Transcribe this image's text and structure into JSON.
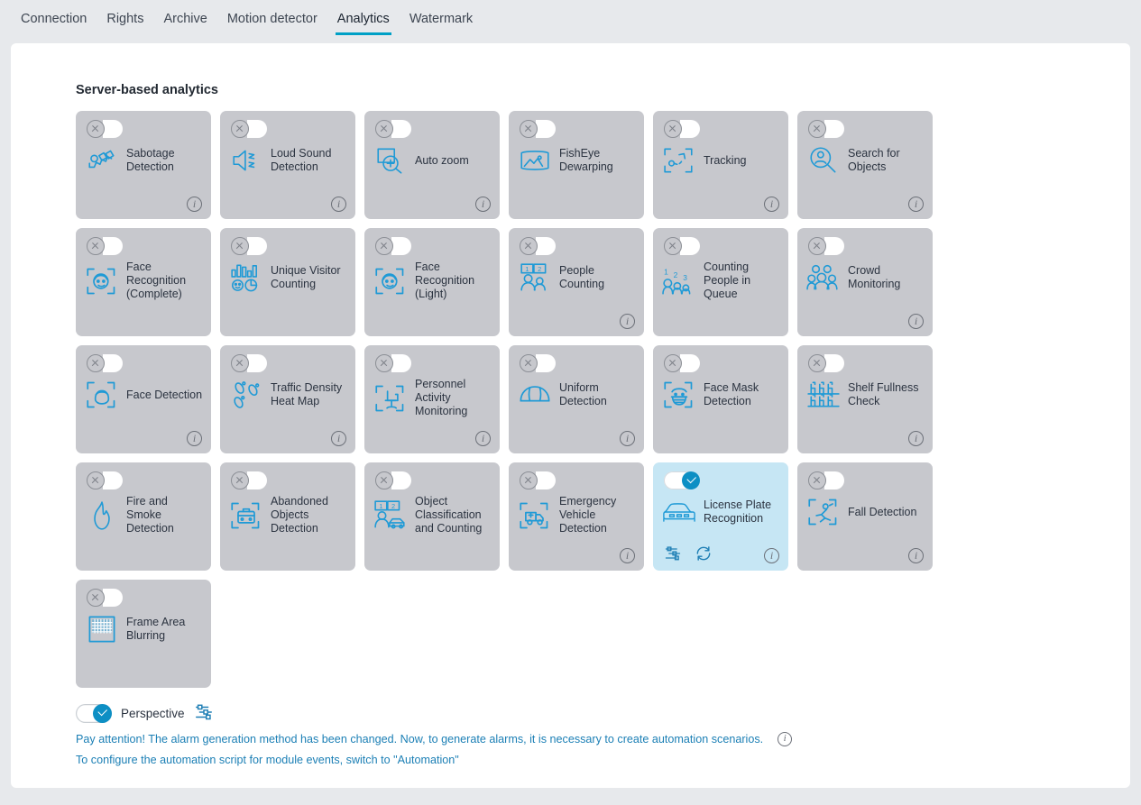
{
  "tabs": [
    {
      "label": "Connection",
      "active": false
    },
    {
      "label": "Rights",
      "active": false
    },
    {
      "label": "Archive",
      "active": false
    },
    {
      "label": "Motion detector",
      "active": false
    },
    {
      "label": "Analytics",
      "active": true
    },
    {
      "label": "Watermark",
      "active": false
    }
  ],
  "section": {
    "title": "Server-based analytics"
  },
  "colors": {
    "accent": "#00a0c6",
    "icon_blue": "#1f9ad6",
    "card_gray": "#c7c8cd",
    "card_active": "#c6e6f4",
    "page_bg": "#e7e9ec",
    "link_blue": "#1b7fb5"
  },
  "cards": [
    {
      "label": "Sabotage Detection",
      "icon": "sabotage-icon",
      "enabled": false,
      "info": true
    },
    {
      "label": "Loud Sound Detection",
      "icon": "loud-sound-icon",
      "enabled": false,
      "info": true
    },
    {
      "label": "Auto zoom",
      "icon": "auto-zoom-icon",
      "enabled": false,
      "info": true
    },
    {
      "label": "FishEye Dewarping",
      "icon": "fisheye-dewarping-icon",
      "enabled": false,
      "info": false
    },
    {
      "label": "Tracking",
      "icon": "tracking-icon",
      "enabled": false,
      "info": true
    },
    {
      "label": "Search for Objects",
      "icon": "search-objects-icon",
      "enabled": false,
      "info": true
    },
    {
      "label": "Face Recognition (Complete)",
      "icon": "face-recognition-icon",
      "enabled": false,
      "info": false
    },
    {
      "label": "Unique Visitor Counting",
      "icon": "unique-visitor-icon",
      "enabled": false,
      "info": false
    },
    {
      "label": "Face Recognition (Light)",
      "icon": "face-recognition-icon",
      "enabled": false,
      "info": false
    },
    {
      "label": "People Counting",
      "icon": "people-counting-icon",
      "enabled": false,
      "info": true
    },
    {
      "label": "Counting People in Queue",
      "icon": "queue-counting-icon",
      "enabled": false,
      "info": false
    },
    {
      "label": "Crowd Monitoring",
      "icon": "crowd-monitoring-icon",
      "enabled": false,
      "info": true
    },
    {
      "label": "Face Detection",
      "icon": "face-detection-icon",
      "enabled": false,
      "info": true
    },
    {
      "label": "Traffic Density Heat Map",
      "icon": "footprints-icon",
      "enabled": false,
      "info": true
    },
    {
      "label": "Personnel Activity Monitoring",
      "icon": "chair-icon",
      "enabled": false,
      "info": true
    },
    {
      "label": "Uniform Detection",
      "icon": "helmet-icon",
      "enabled": false,
      "info": true
    },
    {
      "label": "Face Mask Detection",
      "icon": "face-mask-icon",
      "enabled": false,
      "info": false
    },
    {
      "label": "Shelf Fullness Check",
      "icon": "shelf-icon",
      "enabled": false,
      "info": true
    },
    {
      "label": "Fire and Smoke Detection",
      "icon": "flame-icon",
      "enabled": false,
      "info": false
    },
    {
      "label": "Abandoned Objects Detection",
      "icon": "suitcase-icon",
      "enabled": false,
      "info": false
    },
    {
      "label": "Object Classification and Counting",
      "icon": "object-class-icon",
      "enabled": false,
      "info": false
    },
    {
      "label": "Emergency Vehicle Detection",
      "icon": "ambulance-icon",
      "enabled": false,
      "info": true
    },
    {
      "label": "License Plate Recognition",
      "icon": "car-icon",
      "enabled": true,
      "info": true,
      "actions": [
        "settings-sliders-icon",
        "refresh-icon"
      ]
    },
    {
      "label": "Fall Detection",
      "icon": "fall-detection-icon",
      "enabled": false,
      "info": true
    },
    {
      "label": "Frame Area Blurring",
      "icon": "frame-blur-icon",
      "enabled": false,
      "info": false
    }
  ],
  "perspective": {
    "label": "Perspective",
    "enabled": true,
    "settings_icon": "settings-sliders-icon"
  },
  "notes": [
    {
      "text": "Pay attention! The alarm generation method has been changed. Now, to generate alarms, it is necessary to create automation scenarios.",
      "info": true
    },
    {
      "text": "To configure the automation script for module events, switch to \"Automation\"",
      "info": false
    }
  ]
}
